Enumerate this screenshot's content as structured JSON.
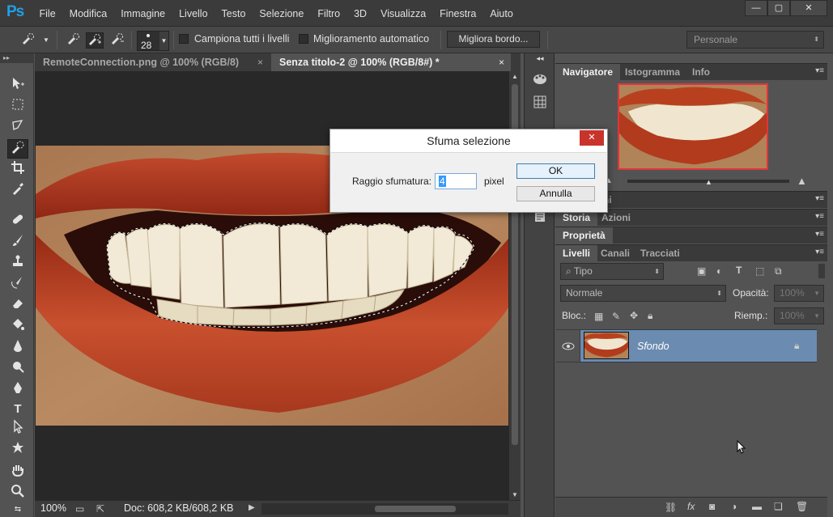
{
  "app": {
    "logo": "Ps"
  },
  "menu": [
    "File",
    "Modifica",
    "Immagine",
    "Livello",
    "Testo",
    "Selezione",
    "Filtro",
    "3D",
    "Visualizza",
    "Finestra",
    "Aiuto"
  ],
  "window_controls": {
    "minimize": "—",
    "maximize": "▢",
    "close": "✕"
  },
  "options": {
    "brush_size": "28",
    "sample_all_layers": "Campiona tutti i livelli",
    "auto_enhance": "Miglioramento automatico",
    "refine_edge": "Migliora bordo...",
    "workspace": "Personale"
  },
  "tabs": [
    {
      "label": "RemoteConnection.png @ 100% (RGB/8)",
      "close": "×"
    },
    {
      "label": "Senza titolo-2 @ 100% (RGB/8#) *",
      "close": "×"
    }
  ],
  "status": {
    "zoom": "100%",
    "doc": "Doc: 608,2 KB/608,2 KB"
  },
  "panels": {
    "navigator_tabs": [
      "Navigatore",
      "Istogramma",
      "Info"
    ],
    "collapsed_label": "ni",
    "history_tabs": [
      "Storia",
      "Azioni"
    ],
    "properties_tab": "Proprietà",
    "layers_tabs": [
      "Livelli",
      "Canali",
      "Tracciati"
    ],
    "filter_kind": "Tipo",
    "blend_mode": "Normale",
    "opacity_label": "Opacità:",
    "opacity_value": "100%",
    "lock_label": "Bloc.:",
    "fill_label": "Riemp.:",
    "fill_value": "100%",
    "layer_name": "Sfondo"
  },
  "dialog": {
    "title": "Sfuma selezione",
    "close": "✕",
    "radius_label": "Raggio sfumatura:",
    "radius_value": "4",
    "unit": "pixel",
    "ok": "OK",
    "cancel": "Annulla"
  },
  "colors": {
    "accent": "#1fa0e6",
    "selected_layer": "#6c8bb0",
    "dialog_close": "#c8342c"
  }
}
